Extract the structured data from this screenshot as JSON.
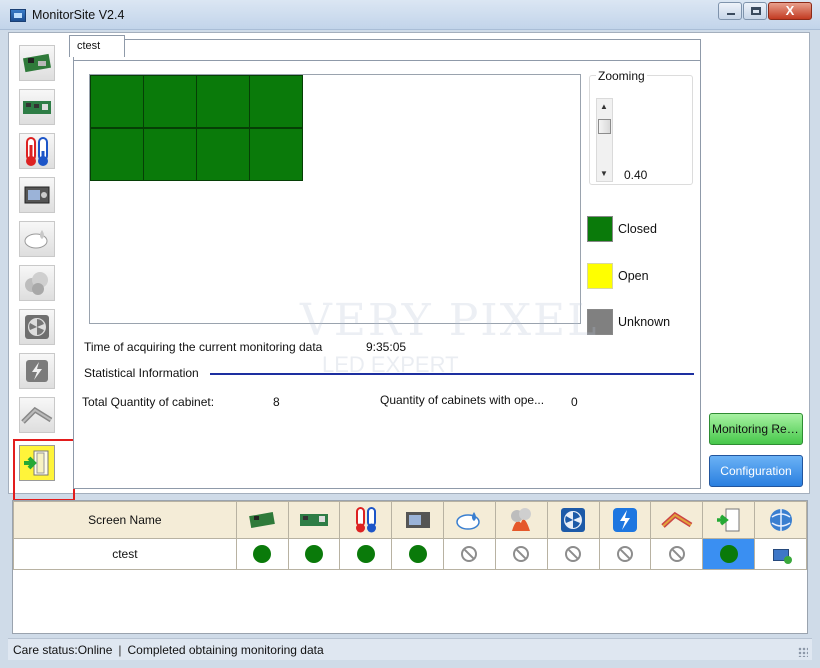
{
  "window": {
    "title": "MonitorSite V2.4",
    "close_glyph": "X"
  },
  "toolbar": {
    "buttons": [
      {
        "name": "receiving-card-icon"
      },
      {
        "name": "hub-card-icon"
      },
      {
        "name": "temperature-icon"
      },
      {
        "name": "module-icon"
      },
      {
        "name": "humidity-icon"
      },
      {
        "name": "smoke-icon"
      },
      {
        "name": "fan-icon"
      },
      {
        "name": "power-icon"
      },
      {
        "name": "cable-icon"
      },
      {
        "name": "cabinet-door-icon",
        "selected": true
      }
    ]
  },
  "tab": {
    "label": "ctest"
  },
  "zoom": {
    "label": "Zooming",
    "value": "0.40"
  },
  "legend": [
    {
      "label": "Closed",
      "color": "#0a7a0a"
    },
    {
      "label": "Open",
      "color": "#ffff00"
    },
    {
      "label": "Unknown",
      "color": "#808080"
    }
  ],
  "cabinet_grid": {
    "rows": 2,
    "cols": 4,
    "color": "#0a7a0a"
  },
  "info": {
    "time_label": "Time of acquiring the current monitoring data",
    "time_value": "9:35:05",
    "stat_label": "Statistical Information",
    "total_label": "Total Quantity of cabinet:",
    "total_value": "8",
    "open_label": "Quantity of cabinets with ope...",
    "open_value": "0"
  },
  "buttons": {
    "monitoring_refresh": "Monitoring Ref...",
    "configuration": "Configuration"
  },
  "watermark": {
    "text": "VERY PIXEL",
    "sub": "LED EXPERT"
  },
  "table": {
    "header_name": "Screen Name",
    "columns": [
      "receiving-card-icon",
      "hub-card-icon",
      "temperature-icon",
      "module-icon",
      "humidity-icon",
      "smoke-icon",
      "fan-icon",
      "power-icon",
      "cable-icon",
      "cabinet-door-icon",
      "network-icon"
    ],
    "rows": [
      {
        "name": "ctest",
        "status": [
          "ok",
          "ok",
          "ok",
          "ok",
          "na",
          "na",
          "na",
          "na",
          "na",
          "ok-selected",
          "monitor"
        ]
      }
    ]
  },
  "status": {
    "care_status": "Care status:Online",
    "separator": "|",
    "message": "Completed obtaining monitoring data"
  }
}
